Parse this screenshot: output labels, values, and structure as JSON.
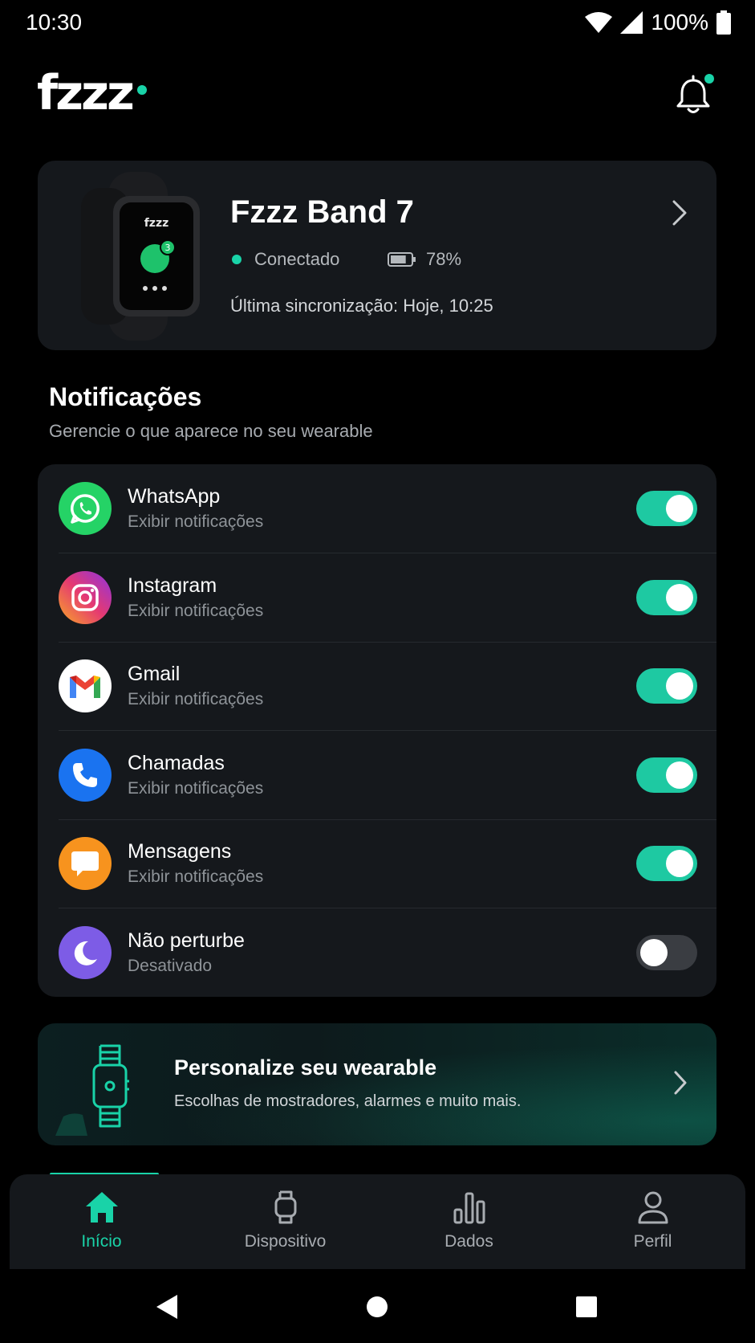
{
  "status_bar": {
    "time": "10:30",
    "battery": "100%"
  },
  "header": {
    "logo_text": "fzzz",
    "brand_color": "#19d3a8",
    "notification_icon": "bell-icon",
    "has_unread": true
  },
  "device": {
    "name": "Fzzz Band 7",
    "status": "Conectado",
    "battery": "78%",
    "battery_fraction": 0.78,
    "last_sync": "Última sincronização: Hoje, 10:25",
    "watch_screen_text": "fzzz",
    "watch_badge": "3"
  },
  "notifications": {
    "title": "Notificações",
    "subtitle": "Gerencie o que aparece no seu wearable",
    "items": [
      {
        "name": "WhatsApp",
        "desc": "Exibir notificações",
        "enabled": true,
        "icon": "whatsapp-icon"
      },
      {
        "name": "Instagram",
        "desc": "Exibir notificações",
        "enabled": true,
        "icon": "instagram-icon"
      },
      {
        "name": "Gmail",
        "desc": "Exibir notificações",
        "enabled": true,
        "icon": "gmail-icon"
      },
      {
        "name": "Chamadas",
        "desc": "Exibir notificações",
        "enabled": true,
        "icon": "phone-icon"
      },
      {
        "name": "Mensagens",
        "desc": "Exibir notificações",
        "enabled": true,
        "icon": "message-icon"
      },
      {
        "name": "Não perturbe",
        "desc": "Desativado",
        "enabled": false,
        "icon": "moon-icon"
      }
    ]
  },
  "promo": {
    "title": "Personalize seu wearable",
    "subtitle": "Escolhas de mostradores, alarmes e muito mais."
  },
  "bottom_nav": {
    "items": [
      {
        "label": "Início",
        "icon": "home-icon",
        "active": true
      },
      {
        "label": "Dispositivo",
        "icon": "watch-icon",
        "active": false
      },
      {
        "label": "Dados",
        "icon": "bar-chart-icon",
        "active": false
      },
      {
        "label": "Perfil",
        "icon": "person-icon",
        "active": false
      }
    ]
  },
  "colors": {
    "accent": "#19d3a8",
    "card": "#15181c",
    "background": "#000000"
  }
}
